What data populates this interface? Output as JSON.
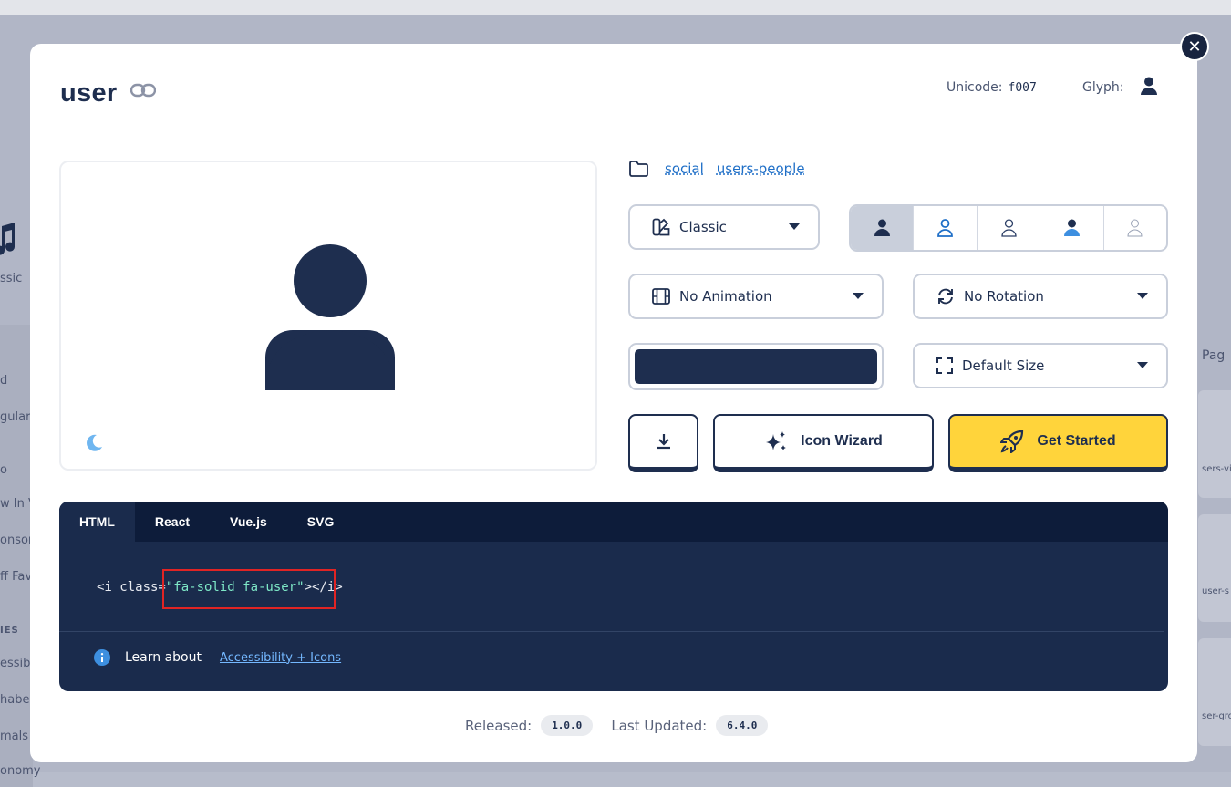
{
  "background": {
    "left_labels": [
      {
        "text": "ssic",
        "top": "298"
      },
      {
        "text": "d",
        "top": "410"
      },
      {
        "text": "gular",
        "top": "450"
      },
      {
        "text": "o",
        "top": "508"
      },
      {
        "text": "w In V",
        "top": "545"
      },
      {
        "text": "onsore",
        "top": "585"
      },
      {
        "text": "ff Fav",
        "top": "625"
      },
      {
        "text": "IES",
        "top": "686"
      },
      {
        "text": "essib",
        "top": "720"
      },
      {
        "text": "habe",
        "top": "760"
      },
      {
        "text": "mals",
        "top": "800"
      },
      {
        "text": "onomy",
        "top": "838"
      }
    ],
    "right_labels": [
      "Pag",
      "sers-vie",
      "user-s",
      "ser-gro"
    ]
  },
  "modal": {
    "title": "user",
    "unicode_label": "Unicode:",
    "unicode_value": "f007",
    "glyph_label": "Glyph:",
    "categories": [
      "social",
      "users-people"
    ],
    "family_select": "Classic",
    "animation_select": "No Animation",
    "rotation_select": "No Rotation",
    "size_select": "Default Size",
    "color_value": "#1e2e4f",
    "wizard_label": "Icon Wizard",
    "started_label": "Get Started",
    "tabs": [
      "HTML",
      "React",
      "Vue.js",
      "SVG"
    ],
    "code": {
      "prefix": "<i class=",
      "value": "\"fa-solid fa-user\"",
      "suffix": "></i>"
    },
    "learn_text": "Learn about",
    "learn_link": "Accessibility + Icons",
    "released_label": "Released:",
    "released_value": "1.0.0",
    "updated_label": "Last Updated:",
    "updated_value": "6.4.0"
  },
  "colors": {
    "navy": "#1e2e4f",
    "accent_blue": "#1f6fc7",
    "yellow": "#ffd43b",
    "code_bg": "#1a2b4c"
  }
}
